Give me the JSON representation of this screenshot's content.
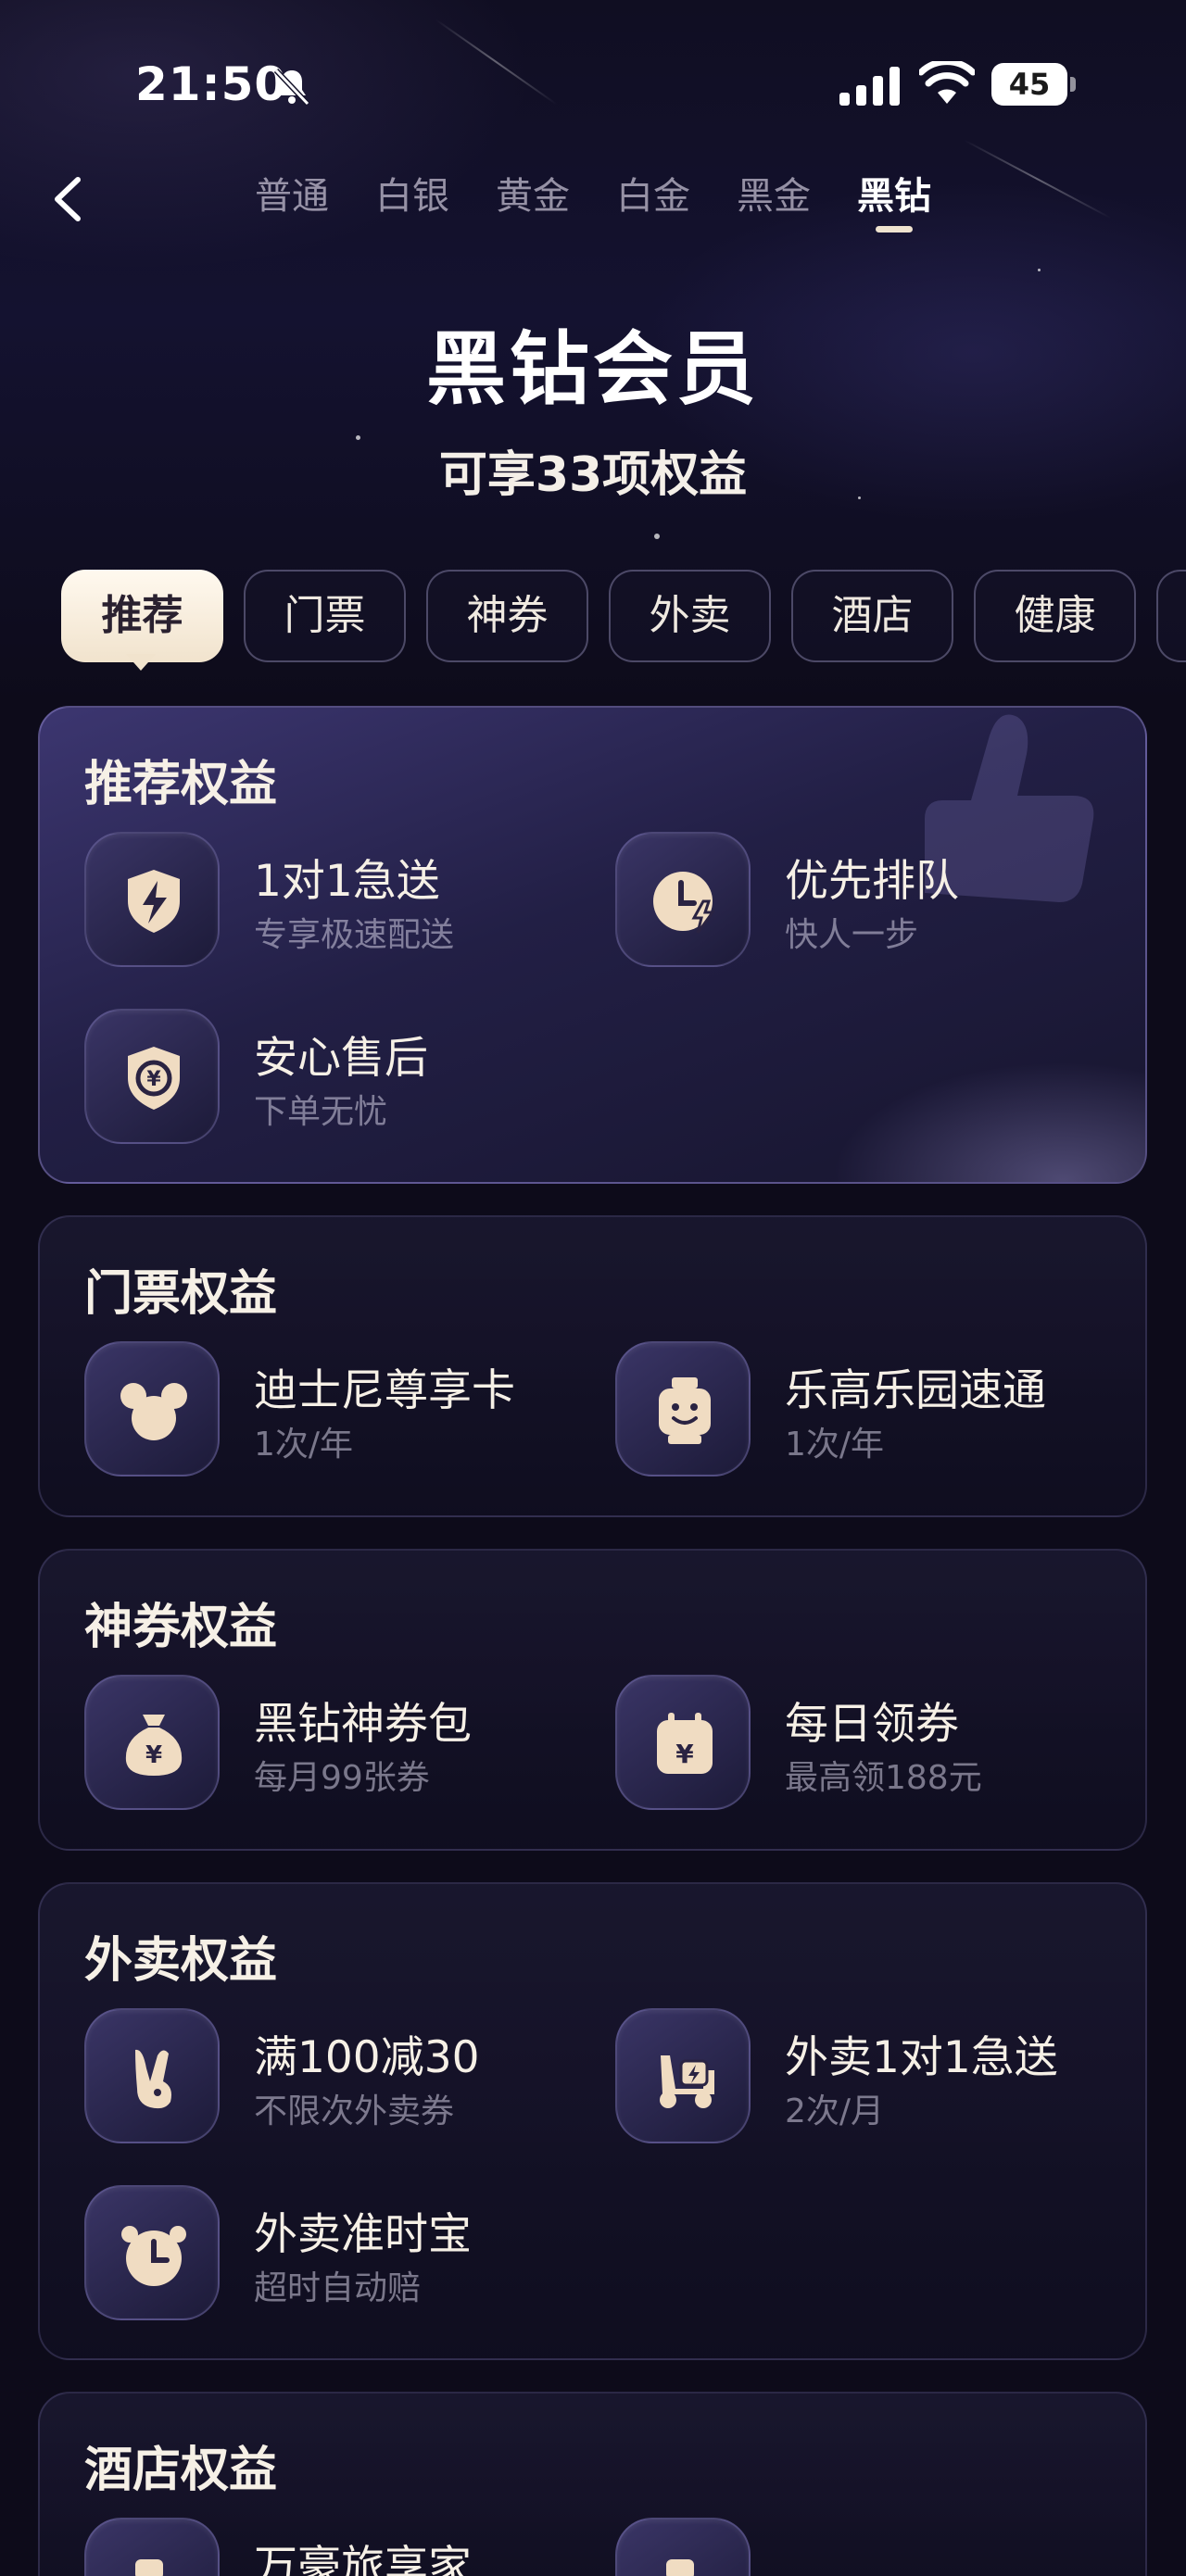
{
  "status_bar": {
    "time": "21:50",
    "battery": "45"
  },
  "header": {
    "tiers": [
      "普通",
      "白银",
      "黄金",
      "白金",
      "黑金",
      "黑钻"
    ],
    "active_tier_index": 5,
    "title": "黑钻会员",
    "subtitle": "可享33项权益"
  },
  "categories": {
    "items": [
      "推荐",
      "门票",
      "神券",
      "外卖",
      "酒店",
      "健康"
    ],
    "active_index": 0
  },
  "sections": {
    "recommend": {
      "title": "推荐权益",
      "items": [
        {
          "title": "1对1急送",
          "desc": "专享极速配送",
          "icon": "lightning-shield-icon"
        },
        {
          "title": "优先排队",
          "desc": "快人一步",
          "icon": "clock-lightning-icon"
        },
        {
          "title": "安心售后",
          "desc": "下单无忧",
          "icon": "yuan-shield-icon"
        }
      ]
    },
    "ticket": {
      "title": "门票权益",
      "items": [
        {
          "title": "迪士尼尊享卡",
          "desc": "1次/年",
          "icon": "mouse-ears-icon"
        },
        {
          "title": "乐高乐园速通",
          "desc": "1次/年",
          "icon": "lego-head-icon"
        }
      ]
    },
    "coupon": {
      "title": "神券权益",
      "items": [
        {
          "title": "黑钻神券包",
          "desc": "每月99张券",
          "icon": "money-bag-icon"
        },
        {
          "title": "每日领券",
          "desc": "最高领188元",
          "icon": "calendar-yuan-icon"
        }
      ]
    },
    "delivery": {
      "title": "外卖权益",
      "items": [
        {
          "title": "满100减30",
          "desc": "不限次外卖券",
          "icon": "kangaroo-icon"
        },
        {
          "title": "外卖1对1急送",
          "desc": "2次/月",
          "icon": "scooter-icon"
        },
        {
          "title": "外卖准时宝",
          "desc": "超时自动赔",
          "icon": "alarm-clock-icon"
        }
      ]
    },
    "hotel": {
      "title": "酒店权益",
      "items": [
        {
          "title": "万豪旅享家",
          "desc": "",
          "icon": "hotel-icon"
        },
        {
          "title": "",
          "desc": "",
          "icon": "hotel-icon"
        }
      ]
    }
  },
  "colors": {
    "background": "#0d0b1a",
    "accent_gold": "#f1e3cd",
    "card": "#1a1830"
  }
}
